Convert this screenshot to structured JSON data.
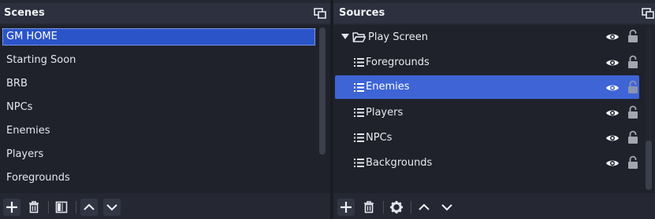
{
  "scenes": {
    "title": "Scenes",
    "selected": "GM HOME",
    "items": [
      "Starting Soon",
      "BRB",
      "NPCs",
      "Enemies",
      "Players",
      "Foregrounds"
    ]
  },
  "sources": {
    "title": "Sources",
    "group": "Play Screen",
    "items": [
      {
        "label": "Foregrounds",
        "selected": false
      },
      {
        "label": "Enemies",
        "selected": true
      },
      {
        "label": "Players",
        "selected": false
      },
      {
        "label": "NPCs",
        "selected": false
      },
      {
        "label": "Backgrounds",
        "selected": false
      }
    ]
  },
  "colors": {
    "panel": "#252833",
    "header": "#2d313f",
    "list": "#1f222b",
    "selection": "#3e64d6",
    "scene_selection": "#2b54c8"
  },
  "icons": {
    "undock": "undock-icon",
    "folder": "folder-open-icon",
    "group_toggle": "caret-down-icon",
    "source_type": "list-icon",
    "visibility": "eye-icon",
    "lock": "unlocked-padlock-icon",
    "add": "plus-icon",
    "remove": "trash-icon",
    "filters": "filter-icon",
    "properties": "gear-icon",
    "move_up": "chevron-up-icon",
    "move_down": "chevron-down-icon"
  }
}
